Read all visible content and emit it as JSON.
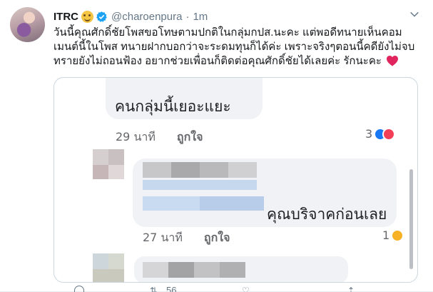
{
  "tweet": {
    "display_name": "ITRC",
    "handle": "@charoenpura",
    "separator": "·",
    "time": "1m",
    "text": "วันนี้คุณศักดิ์ชัยโพสขอโทษตามปกติในกลุ่มกปส.นะคะ แต่พอดีทนายเห็นคอมเมนต์นี้ในโพส ทนายฝากบอกว่าจะระดมทุนก็ได้ค่ะ เพราะจริงๆตอนนี้คดียังไม่จบ ทรายยังไม่ถอนฟ้อง อยากช่วยเพื่อนก็ติดต่อคุณศักดิ์ชัยได้เลยค่ะ รักนะคะ"
  },
  "media": {
    "comment1": {
      "text": "คนกลุ่มนี้เยอะแยะ",
      "time": "29 นาที",
      "like_label": "ถูกใจ",
      "reaction_count": "3"
    },
    "comment2": {
      "text": "คุณบริจาคก่อนเลย",
      "time": "27 นาที",
      "like_label": "ถูกใจ",
      "reaction_count": "1"
    }
  },
  "actions": {
    "retweet_count": "56"
  },
  "colors": {
    "link_blue": "#1da1f2",
    "heart_red": "#e0245e",
    "meta_gray": "#657786"
  },
  "icons": [
    "emoji-face-icon",
    "verified-badge-icon",
    "chevron-down-icon",
    "red-heart-icon",
    "like-reaction-icon",
    "love-reaction-icon",
    "haha-reaction-icon"
  ]
}
